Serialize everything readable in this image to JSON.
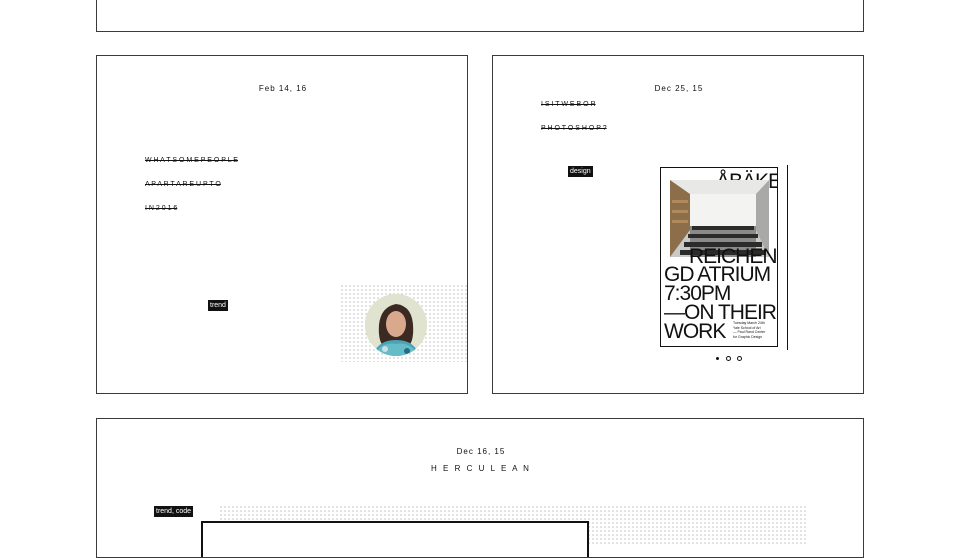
{
  "cards": [
    {
      "date": "Feb 14, 16",
      "title_lines": [
        "W H A T   S O M E   P E O P L E",
        "A P A R T   A R E   U P   T O",
        "I N   2 0 1 6"
      ],
      "tag": "trend"
    },
    {
      "date": "Dec 25, 15",
      "title_lines": [
        "I S   I T   W E B   O R",
        "P H O T O S H O P ?"
      ],
      "tag": "design",
      "poster": {
        "lines": [
          "ÅBÄKE",
          "REICHEN",
          "GD ATRIUM",
          "7:30PM",
          "—ON THEIR",
          "WORK"
        ],
        "fine_print": [
          "Tuesday March 24th",
          "Yale School of Art",
          "— Paul Rand Center",
          "for Graphic Design"
        ]
      }
    },
    {
      "date": "Dec 16, 15",
      "title_lines": [
        "H E R C U L E A N"
      ],
      "tag": "trend, code"
    }
  ],
  "colors": {
    "ink": "#111111",
    "tag_bg": "#111111",
    "tag_fg": "#ffffff",
    "border": "#3a3a3a"
  }
}
